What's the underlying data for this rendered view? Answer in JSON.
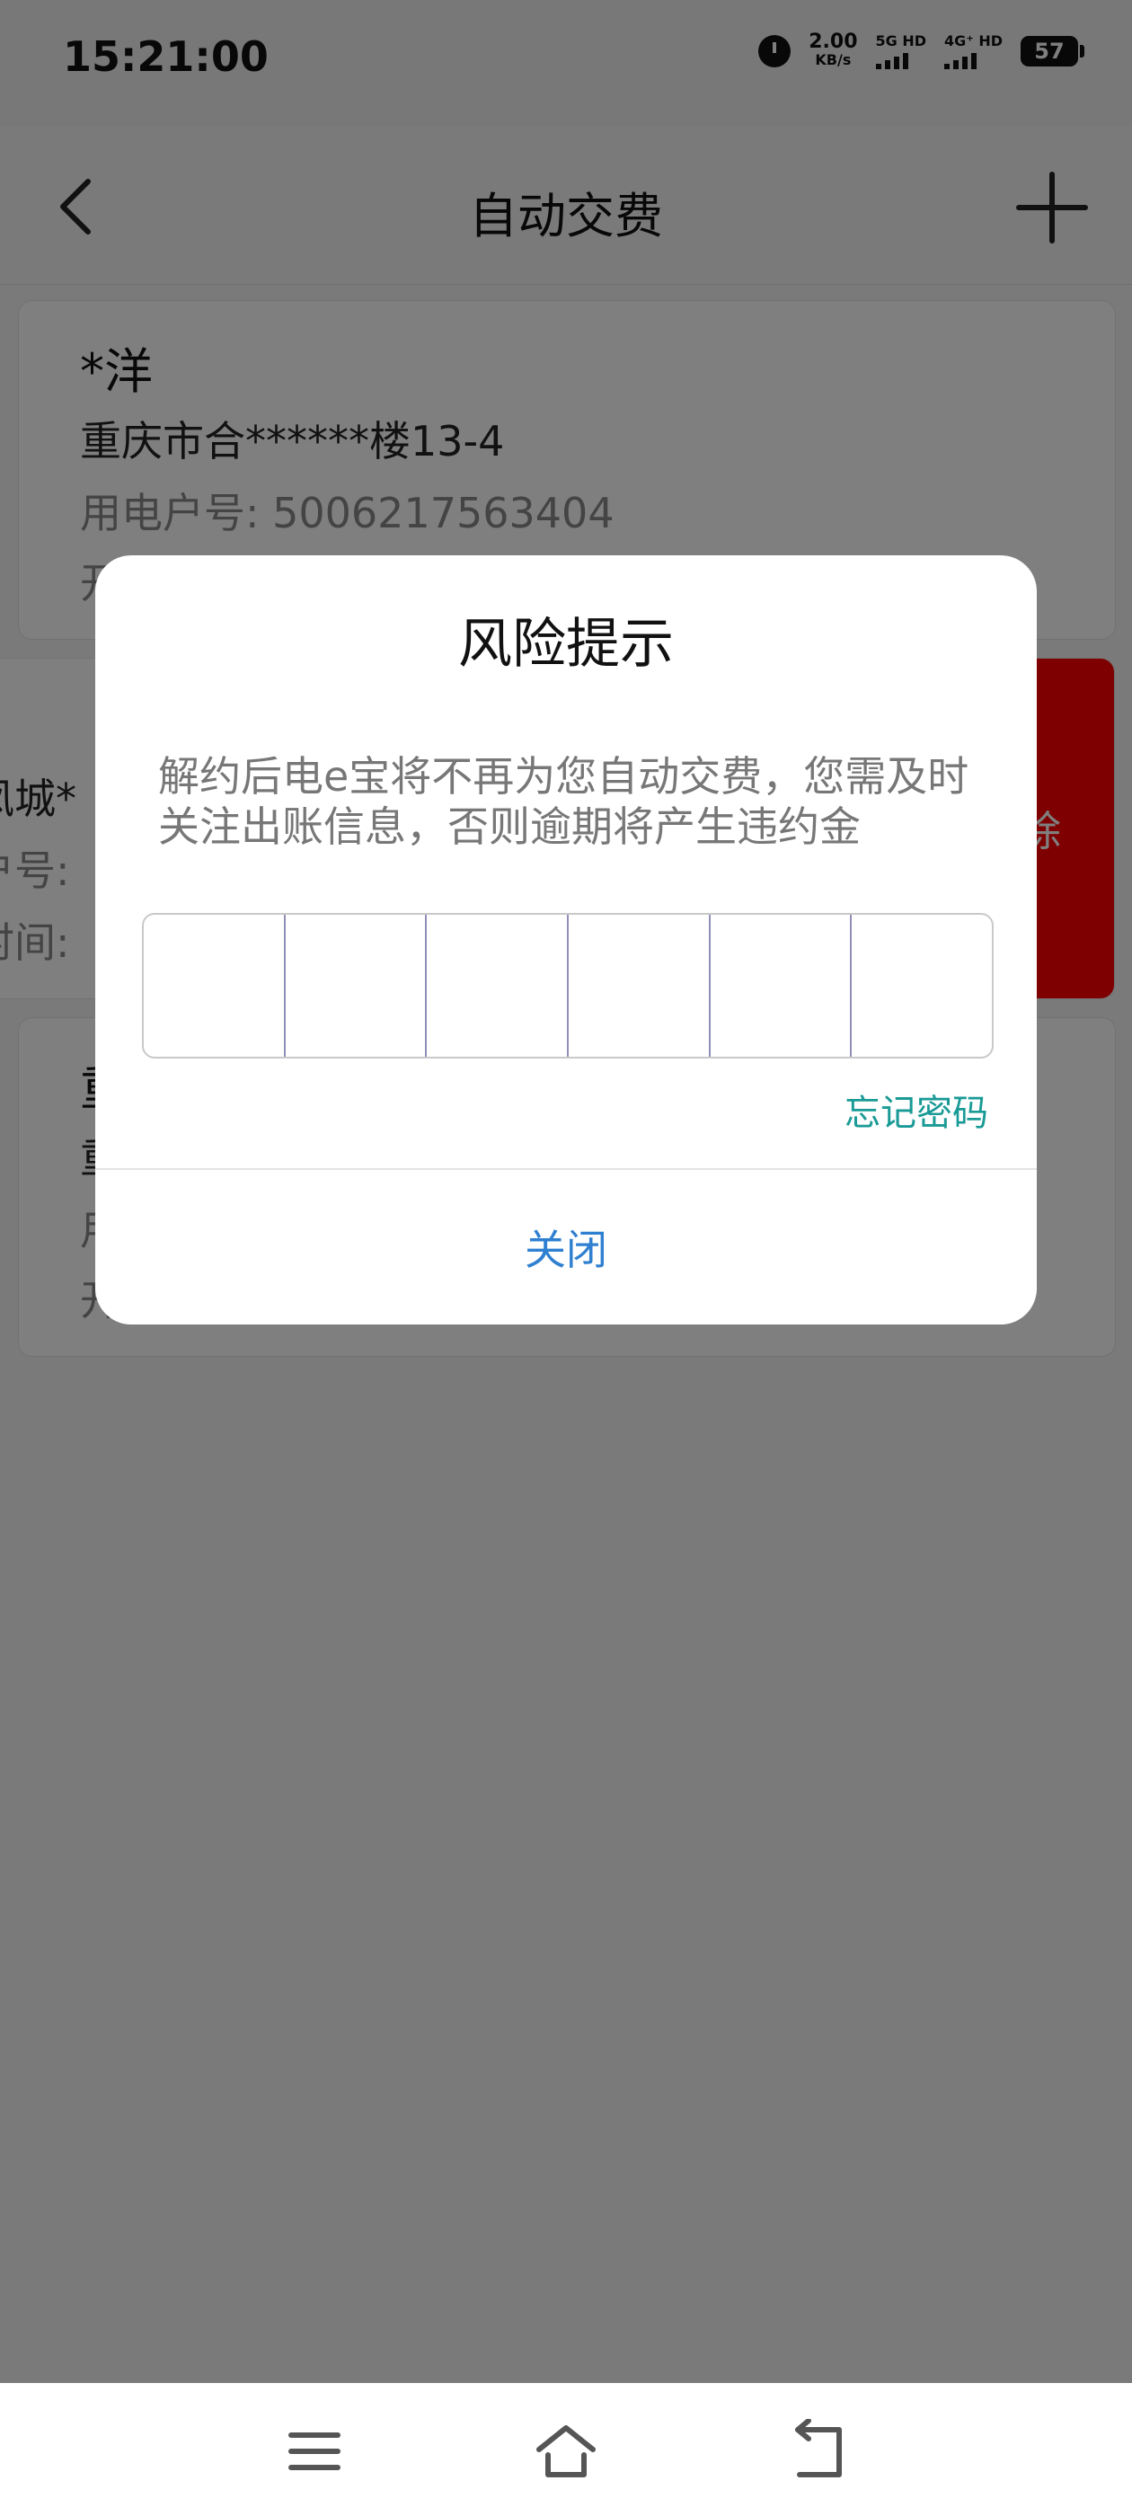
{
  "status_bar": {
    "time": "15:21:00",
    "speed_value": "2.00",
    "speed_unit": "KB/s",
    "sim1_label": "5G HD",
    "sim2_label": "4G⁺ HD",
    "battery": "57",
    "icons": [
      "alarm-icon",
      "signal-icon",
      "battery-icon"
    ]
  },
  "header": {
    "title": "自动交费",
    "back_icon": "chevron-left-icon",
    "add_icon": "plus-icon"
  },
  "cards": [
    {
      "name": "*洋",
      "address": "重庆市合******楼13-4",
      "account": "用电户号: 5006217563404",
      "extra": "开"
    },
    {
      "name": "*",
      "address": "凤城*",
      "account": "户号:",
      "time": "时间:",
      "delete_label": "删除"
    },
    {
      "name": "重",
      "address": "重",
      "account": "用",
      "extra": "开"
    }
  ],
  "dialog": {
    "title": "风险提示",
    "message": "解约后电e宝将不再为您自动交费，您需及时关注出账信息，否则逾期将产生违约金",
    "pin_length": 6,
    "forgot_label": "忘记密码",
    "close_label": "关闭"
  },
  "nav_bar": {
    "icons": [
      "menu-icon",
      "home-icon",
      "back-icon"
    ]
  },
  "colors": {
    "accent_teal": "#1a9a96",
    "accent_blue": "#2f80d1",
    "delete_red": "#ff0000"
  }
}
